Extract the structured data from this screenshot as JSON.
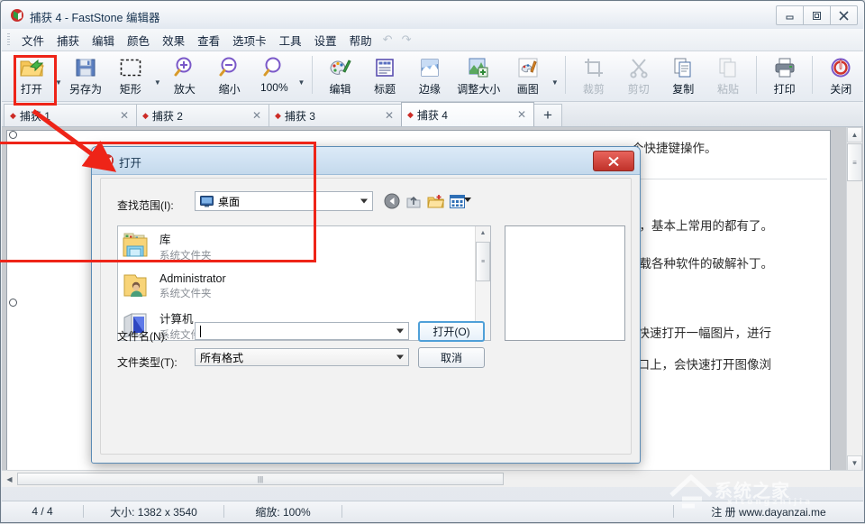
{
  "window": {
    "title": "捕获 4 - FastStone 编辑器",
    "icon": "faststone-logo-icon",
    "controls": {
      "minimize": "—",
      "maximize": "❐",
      "close": "✕"
    }
  },
  "menu": {
    "items": [
      "文件",
      "捕获",
      "编辑",
      "颜色",
      "效果",
      "查看",
      "选项卡",
      "工具",
      "设置",
      "帮助"
    ],
    "undo": "↶",
    "redo": "↷"
  },
  "toolbar": {
    "buttons": [
      {
        "label": "打开",
        "icon": "open-folder-icon",
        "dropdown": true,
        "disabled": false,
        "highlighted": true
      },
      {
        "label": "另存为",
        "icon": "floppy-save-icon",
        "dropdown": false,
        "disabled": false
      },
      {
        "label": "矩形",
        "icon": "marquee-rectangle-icon",
        "dropdown": true,
        "disabled": false
      },
      {
        "label": "放大",
        "icon": "zoom-in-icon",
        "dropdown": false,
        "disabled": false
      },
      {
        "label": "缩小",
        "icon": "zoom-out-icon",
        "dropdown": false,
        "disabled": false
      },
      {
        "label": "100%",
        "icon": "zoom-actual-icon",
        "dropdown": true,
        "disabled": false
      },
      {
        "label": "编辑",
        "icon": "draw-palette-icon",
        "dropdown": false,
        "disabled": false
      },
      {
        "label": "标题",
        "icon": "caption-icon",
        "dropdown": false,
        "disabled": false
      },
      {
        "label": "边缘",
        "icon": "edge-effect-icon",
        "dropdown": false,
        "disabled": false
      },
      {
        "label": "调整大小",
        "icon": "resize-image-icon",
        "dropdown": false,
        "disabled": false
      },
      {
        "label": "画图",
        "icon": "paint-brush-icon",
        "dropdown": true,
        "disabled": false
      },
      {
        "label": "裁剪",
        "icon": "crop-icon",
        "dropdown": false,
        "disabled": true
      },
      {
        "label": "剪切",
        "icon": "scissors-cut-icon",
        "dropdown": false,
        "disabled": true
      },
      {
        "label": "复制",
        "icon": "copy-icon",
        "dropdown": false,
        "disabled": false
      },
      {
        "label": "粘贴",
        "icon": "paste-icon",
        "dropdown": false,
        "disabled": true
      },
      {
        "label": "打印",
        "icon": "printer-icon",
        "dropdown": false,
        "disabled": false
      },
      {
        "label": "关闭",
        "icon": "power-close-icon",
        "dropdown": false,
        "disabled": false
      }
    ]
  },
  "tabs": {
    "items": [
      {
        "label": "捕获 1",
        "active": false,
        "close": "✕"
      },
      {
        "label": "捕获 2",
        "active": false,
        "close": "✕"
      },
      {
        "label": "捕获 3",
        "active": false,
        "close": "✕"
      },
      {
        "label": "捕获 4",
        "active": true,
        "close": "✕"
      }
    ],
    "add_label": "+"
  },
  "document": {
    "lines": [
      "个快捷键操作。",
      "等，基本上常用的都有了。",
      "下载各种软件的破解补丁。",
      "标快速打开一幅图片，进行",
      "窗口上，会快速打开图像浏"
    ]
  },
  "dialog": {
    "title": "打开",
    "icon": "faststone-logo-icon",
    "close_label": "✕",
    "lookin_label": "查找范围(I):",
    "lookin_value": "桌面",
    "lookin_icon": "desktop-monitor-icon",
    "nav": [
      {
        "name": "back-navigation-icon",
        "glyph": "◀"
      },
      {
        "name": "up-one-level-icon",
        "glyph": "↑"
      },
      {
        "name": "new-folder-icon",
        "glyph": "▣"
      },
      {
        "name": "views-menu-icon",
        "glyph": "▦"
      }
    ],
    "files": [
      {
        "name": "库",
        "sub": "系统文件夹",
        "icon": "library-folder-icon"
      },
      {
        "name": "Administrator",
        "sub": "系统文件夹",
        "icon": "user-folder-icon"
      },
      {
        "name": "计算机",
        "sub": "系统文件夹",
        "icon": "computer-icon"
      }
    ],
    "filename_label": "文件名(N):",
    "filename_value": "",
    "filetype_label": "文件类型(T):",
    "filetype_value": "所有格式",
    "open_button": "打开(O)",
    "cancel_button": "取消"
  },
  "status": {
    "page": "4 / 4",
    "size": "大小: 1382 x 3540",
    "zoom": "缩放: 100%",
    "note": "注 册 www.dayanzai.me"
  },
  "watermark": {
    "text": "系统之家",
    "sub": "xitongzhijia"
  },
  "colors": {
    "accent_red": "#ee2418",
    "title_blue": "#17344f",
    "dialog_titlebar": "#cfe1f2",
    "close_red": "#c0322a",
    "tab_diamond": "#cc2b26"
  }
}
